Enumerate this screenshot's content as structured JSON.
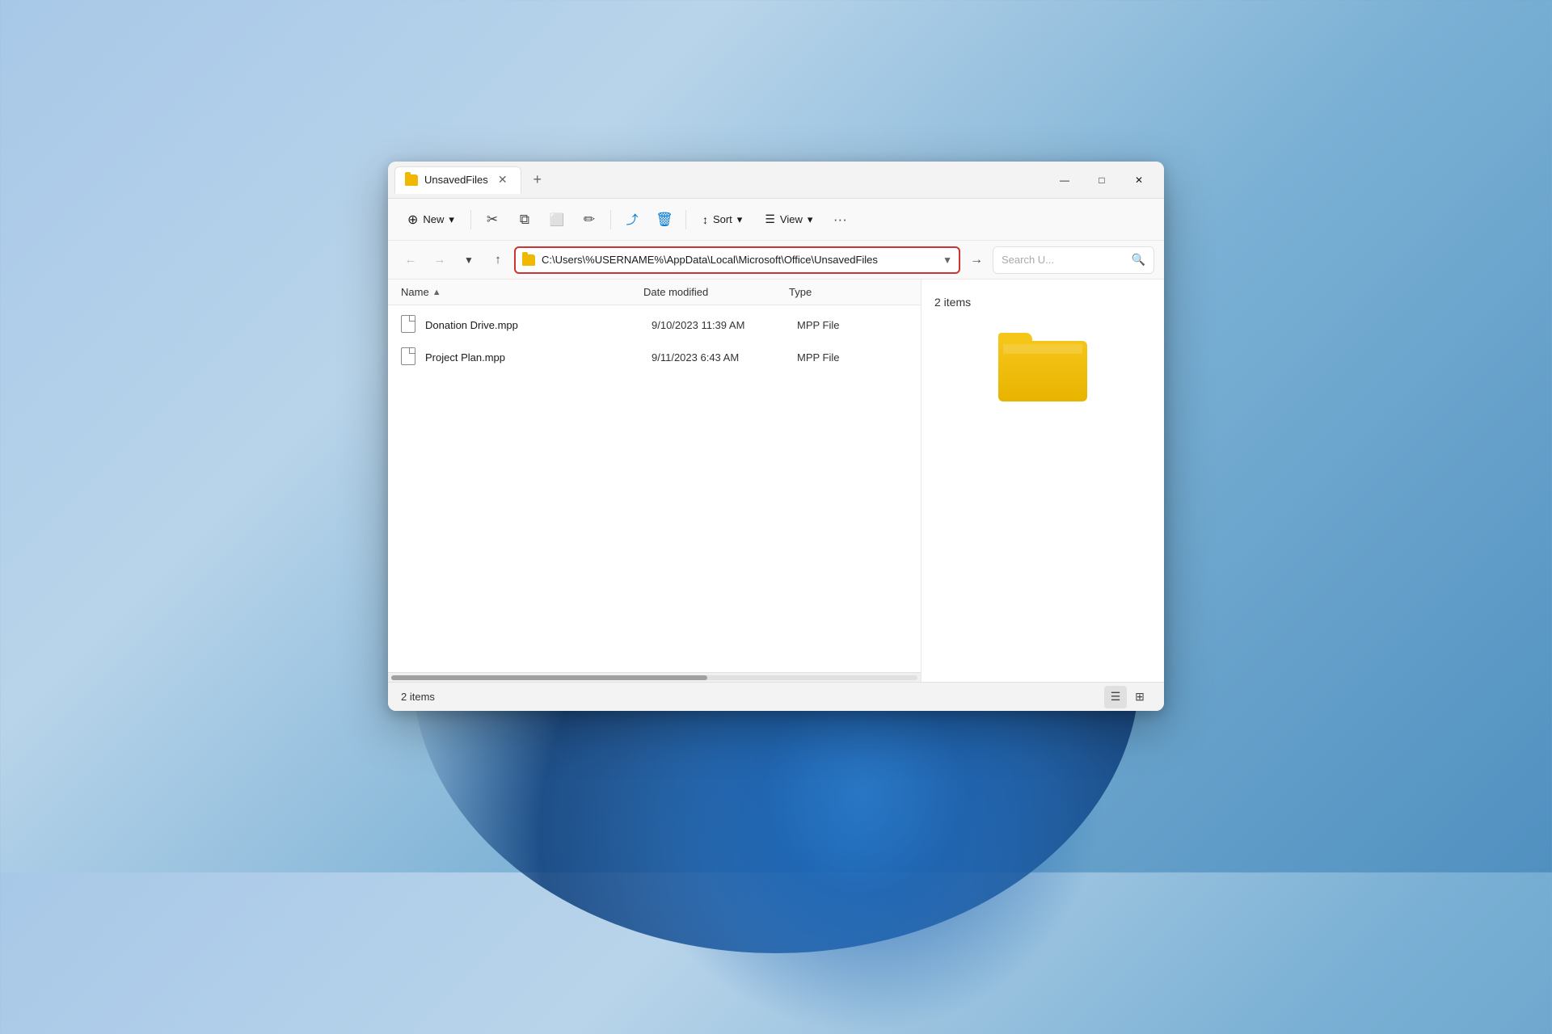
{
  "window": {
    "title": "UnsavedFiles",
    "tab_label": "UnsavedFiles",
    "new_tab_tooltip": "New tab"
  },
  "titlebar_controls": {
    "minimize": "—",
    "maximize": "□",
    "close": "✕"
  },
  "toolbar": {
    "new_label": "New",
    "new_chevron": "▾",
    "sort_label": "Sort",
    "sort_chevron": "▾",
    "view_label": "View",
    "view_chevron": "▾",
    "more_label": "···",
    "cut_icon": "✂",
    "copy_icon": "⧉",
    "paste_icon": "📋",
    "rename_icon": "✏",
    "share_icon": "⤴",
    "delete_icon": "🗑"
  },
  "address_bar": {
    "path": "C:\\Users\\%USERNAME%\\AppData\\Local\\Microsoft\\Office\\UnsavedFiles",
    "search_placeholder": "Search U...",
    "go_icon": "→"
  },
  "file_list": {
    "col_name": "Name",
    "col_date_modified": "Date modified",
    "col_type": "Type",
    "files": [
      {
        "name": "Donation Drive.mpp",
        "date_modified": "9/10/2023 11:39 AM",
        "type": "MPP File"
      },
      {
        "name": "Project Plan.mpp",
        "date_modified": "9/11/2023 6:43 AM",
        "type": "MPP File"
      }
    ]
  },
  "preview": {
    "item_count": "2 items"
  },
  "statusbar": {
    "item_count": "2 items"
  }
}
